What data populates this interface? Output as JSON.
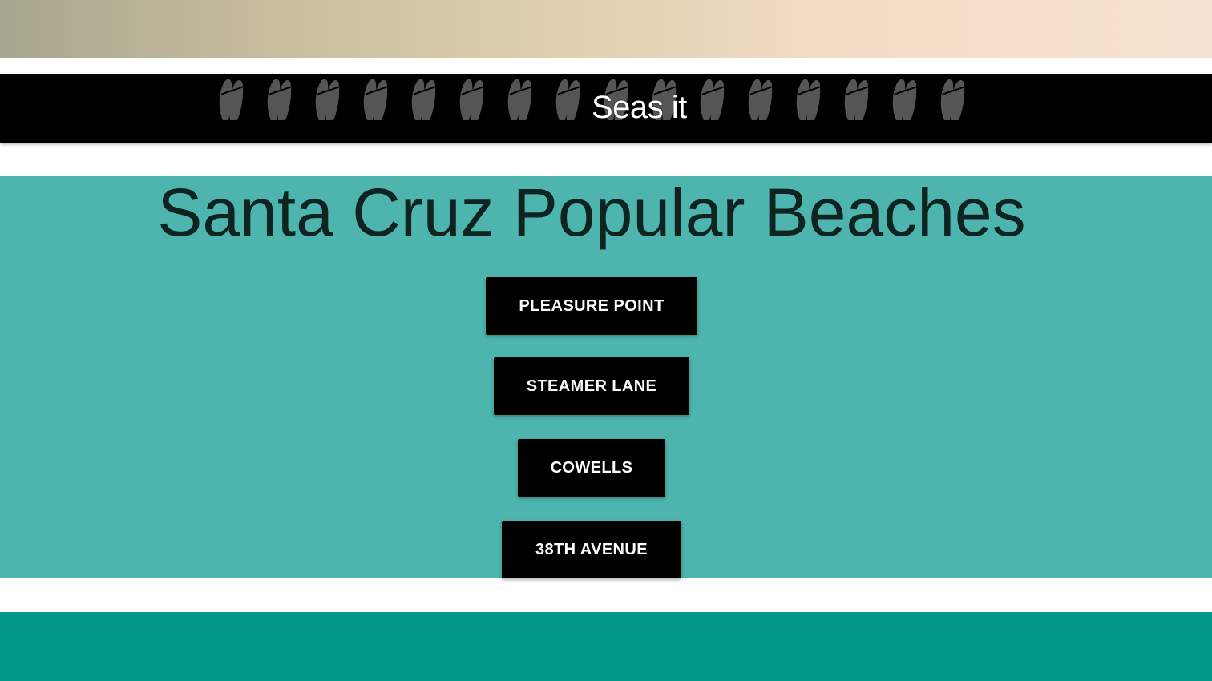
{
  "header": {
    "brand": "Seas it",
    "surfboard_icon_count": 16
  },
  "main": {
    "heading": "Santa Cruz Popular Beaches",
    "beaches": [
      {
        "label": "Pleasure Point"
      },
      {
        "label": "Steamer Lane"
      },
      {
        "label": "Cowells"
      },
      {
        "label": "38th Avenue"
      }
    ]
  },
  "colors": {
    "nav_background": "#000000",
    "section_background": "#4db5ae",
    "footer_background": "#009688",
    "button_background": "#000000",
    "button_text": "#ffffff",
    "heading_text": "#0f2321",
    "surfboard_icon": "#555555"
  }
}
